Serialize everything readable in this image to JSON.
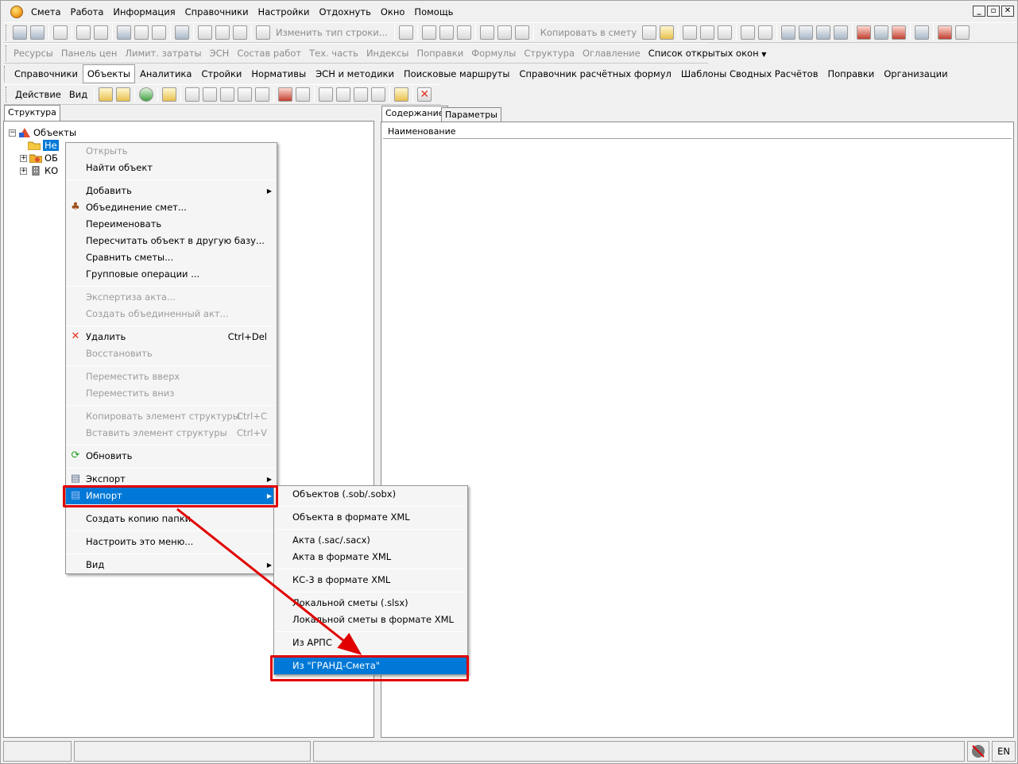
{
  "menubar": {
    "items": [
      "Смета",
      "Работа",
      "Информация",
      "Справочники",
      "Настройки",
      "Отдохнуть",
      "Окно",
      "Помощь"
    ]
  },
  "toolbar1": {
    "change_row_type": "Изменить тип строки...",
    "copy_to_estimate": "Копировать в смету"
  },
  "toolbar2": {
    "items": [
      "Ресурсы",
      "Панель цен",
      "Лимит. затраты",
      "ЭСН",
      "Состав работ",
      "Тех. часть",
      "Индексы",
      "Поправки",
      "Формулы",
      "Структура",
      "Оглавление"
    ],
    "open_windows": "Список открытых окон"
  },
  "nav_tabs": [
    "Справочники",
    "Объекты",
    "Аналитика",
    "Стройки",
    "Нормативы",
    "ЭСН и методики",
    "Поисковые маршруты",
    "Справочник расчётных формул",
    "Шаблоны Сводных Расчётов",
    "Поправки",
    "Организации"
  ],
  "toolbar3": {
    "action": "Действие",
    "view": "Вид"
  },
  "left_panel": {
    "tab": "Структура"
  },
  "tree": {
    "root": "Объекты",
    "child1": "Не",
    "child2": "ОБ",
    "child3": "КО"
  },
  "right_panel": {
    "tab_content": "Содержание",
    "tab_params": "Параметры",
    "column": "Наименование"
  },
  "context_menu": [
    {
      "label": "Открыть",
      "disabled": true
    },
    {
      "label": "Найти объект"
    },
    {
      "sep": true
    },
    {
      "label": "Добавить",
      "sub": true
    },
    {
      "label": "Объединение смет...",
      "icon": "merge-icon"
    },
    {
      "label": "Переименовать"
    },
    {
      "label": "Пересчитать объект в другую базу..."
    },
    {
      "label": "Сравнить сметы..."
    },
    {
      "label": "Групповые операции ..."
    },
    {
      "sep": true
    },
    {
      "label": "Экспертиза акта...",
      "disabled": true
    },
    {
      "label": "Создать объединенный акт...",
      "disabled": true
    },
    {
      "sep": true
    },
    {
      "label": "Удалить",
      "shortcut": "Ctrl+Del",
      "icon": "delete-icon"
    },
    {
      "label": "Восстановить",
      "disabled": true
    },
    {
      "sep": true
    },
    {
      "label": "Переместить вверх",
      "disabled": true
    },
    {
      "label": "Переместить вниз",
      "disabled": true
    },
    {
      "sep": true
    },
    {
      "label": "Копировать элемент структуры",
      "shortcut": "Ctrl+C",
      "disabled": true
    },
    {
      "label": "Вставить элемент структуры",
      "shortcut": "Ctrl+V",
      "disabled": true
    },
    {
      "sep": true
    },
    {
      "label": "Обновить",
      "icon": "refresh-icon"
    },
    {
      "sep": true
    },
    {
      "label": "Экспорт",
      "sub": true,
      "icon": "export-icon"
    },
    {
      "label": "Импорт",
      "sub": true,
      "icon": "import-icon",
      "highlight": true
    },
    {
      "sep": true
    },
    {
      "label": "Создать копию папки"
    },
    {
      "sep": true
    },
    {
      "label": "Настроить это меню..."
    },
    {
      "sep": true
    },
    {
      "label": "Вид",
      "sub": true
    }
  ],
  "import_submenu": [
    {
      "label": "Объектов (.sob/.sobx)"
    },
    {
      "sep": true
    },
    {
      "label": "Объекта в формате XML"
    },
    {
      "sep": true
    },
    {
      "label": "Акта (.sac/.sacx)"
    },
    {
      "label": "Акта в формате XML"
    },
    {
      "sep": true
    },
    {
      "label": "КС-3 в формате XML"
    },
    {
      "sep": true
    },
    {
      "label": "Локальной сметы (.slsx)"
    },
    {
      "label": "Локальной сметы в формате XML"
    },
    {
      "sep": true
    },
    {
      "label": "Из АРПС"
    },
    {
      "sep": true
    },
    {
      "label": "Из \"ГРАНД-Смета\"",
      "highlight": true
    }
  ],
  "statusbar": {
    "lang": "EN"
  },
  "colors": {
    "highlight": "#0078d7",
    "annotation": "#e00000"
  }
}
